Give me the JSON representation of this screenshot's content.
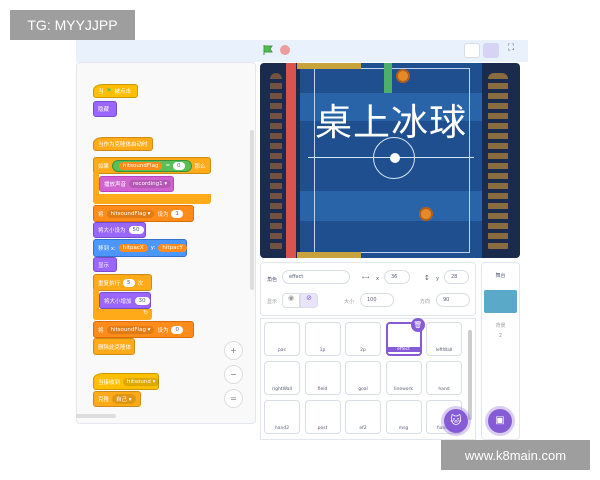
{
  "watermarks": {
    "top_left": "TG: MYYJJPP",
    "bottom_right": "www.k8main.com"
  },
  "colors": {
    "accent": "#855cd6",
    "events": "#ffbf00",
    "control": "#ffab19",
    "looks": "#9966ff",
    "sound": "#cf63cf",
    "variables": "#ff8c1a",
    "motion": "#4c97ff",
    "operators": "#59c059"
  },
  "code": {
    "when_flag_clicked": {
      "pre": "当",
      "post": "被点击"
    },
    "hide": "隐藏",
    "when_clone_start": "当作为克隆体启动时",
    "if": {
      "label": "如果",
      "var": "hitsoundFlag",
      "op": "=",
      "value": "0",
      "then": "那么"
    },
    "play_sound": {
      "label": "播放声音",
      "sound": "recording1"
    },
    "set_var1": {
      "label": "将",
      "var": "hitsoundFlag",
      "to": "设为",
      "value": "1"
    },
    "set_size": {
      "label": "将大小设为",
      "value": "50"
    },
    "goto": {
      "label": "移到 x:",
      "x": "hitpacX",
      "y_label": "y:",
      "y": "hitpacY"
    },
    "show": "显示",
    "repeat": {
      "label": "重复执行",
      "value": "5",
      "times": "次"
    },
    "change_size": {
      "label": "将大小增加",
      "value": "30"
    },
    "set_var0": {
      "label": "将",
      "var": "hitsoundFlag",
      "to": "设为",
      "value": "0"
    },
    "delete_clone": "删除此克隆体",
    "when_receive": {
      "label": "当接收到",
      "msg": "hitsound"
    },
    "clone": {
      "label": "克隆",
      "target": "自己"
    },
    "zoom_in": "+",
    "zoom_out": "−",
    "zoom_reset": "="
  },
  "stage": {
    "title": "桌上冰球"
  },
  "sprite_info": {
    "sprite_label": "角色",
    "sprite_name": "effect",
    "x_label": "x",
    "x": "36",
    "y_label": "y",
    "y": "28",
    "show_label": "显示",
    "size_label": "大小",
    "size": "100",
    "direction_label": "方向",
    "direction": "90"
  },
  "sprites": [
    {
      "name": "pac"
    },
    {
      "name": "1p"
    },
    {
      "name": "2p"
    },
    {
      "name": "effect",
      "selected": true
    },
    {
      "name": "leftWall"
    },
    {
      "name": "rightWall"
    },
    {
      "name": "field"
    },
    {
      "name": "goal"
    },
    {
      "name": "linework"
    },
    {
      "name": "hand"
    },
    {
      "name": "hand2"
    },
    {
      "name": "post"
    },
    {
      "name": "ef2"
    },
    {
      "name": "msg"
    },
    {
      "name": "hand3"
    }
  ],
  "stage_panel": {
    "title": "舞台",
    "backdrops_label": "背景",
    "backdrops_count": "2"
  }
}
